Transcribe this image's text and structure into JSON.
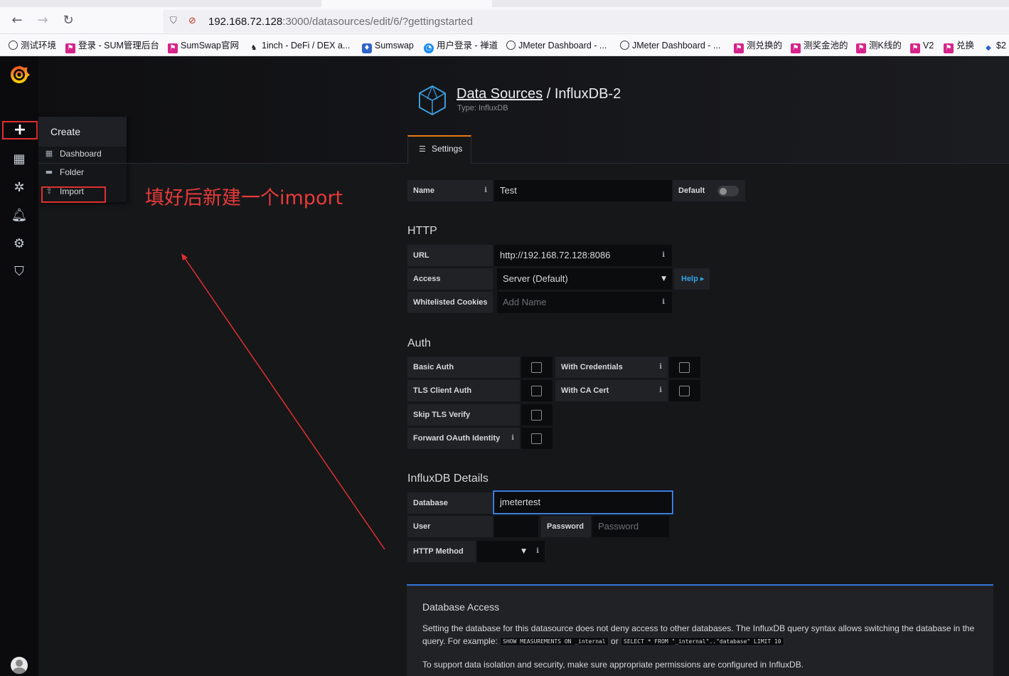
{
  "browser": {
    "url_host": "192.168.72.128",
    "url_path": ":3000/datasources/edit/6/?gettingstarted",
    "back_icon": "back-arrow-icon",
    "forward_icon": "forward-arrow-icon",
    "reload_icon": "reload-icon"
  },
  "bookmarks": [
    {
      "label": "测试环境",
      "icon": "globe-icon"
    },
    {
      "label": "登录 - SUM管理后台",
      "icon": "pink-flag-icon"
    },
    {
      "label": "SumSwap官网",
      "icon": "pink-flag-icon"
    },
    {
      "label": "1inch - DeFi / DEX a...",
      "icon": "unicorn-icon"
    },
    {
      "label": "Sumswap",
      "icon": "sumswap-icon"
    },
    {
      "label": "用户登录 - 禅道",
      "icon": "zentao-icon"
    },
    {
      "label": "JMeter Dashboard - ...",
      "icon": "globe-icon"
    },
    {
      "label": "JMeter Dashboard - ...",
      "icon": "globe-icon"
    },
    {
      "label": "测兑换的",
      "icon": "pink-flag-icon"
    },
    {
      "label": "测奖金池的",
      "icon": "pink-flag-icon"
    },
    {
      "label": "测K线的",
      "icon": "pink-flag-icon"
    },
    {
      "label": "V2",
      "icon": "pink-flag-icon"
    },
    {
      "label": "兑换",
      "icon": "pink-flag-icon"
    },
    {
      "label": "$2",
      "icon": "diamond-icon"
    }
  ],
  "sidemenu": {
    "create_menu": {
      "title": "Create",
      "items": [
        {
          "label": "Dashboard",
          "icon": "dashboard-icon"
        },
        {
          "label": "Folder",
          "icon": "folder-icon"
        },
        {
          "label": "Import",
          "icon": "import-icon"
        }
      ]
    }
  },
  "annotation": {
    "text": "填好后新建一个import",
    "color": "#e83a3a"
  },
  "header": {
    "breadcrumb_link": "Data Sources",
    "separator": " / ",
    "title": "InfluxDB-2",
    "subtitle": "Type: InfluxDB"
  },
  "tabs": [
    {
      "label": "Settings",
      "active": true
    }
  ],
  "form": {
    "name_label": "Name",
    "name_value": "Test",
    "default_label": "Default",
    "default_on": false,
    "http_title": "HTTP",
    "url_label": "URL",
    "url_value": "http://192.168.72.128:8086",
    "access_label": "Access",
    "access_value": "Server (Default)",
    "help_label": "Help ▸",
    "cookies_label": "Whitelisted Cookies",
    "cookies_placeholder": "Add Name",
    "auth_title": "Auth",
    "basic_auth": "Basic Auth",
    "with_credentials": "With Credentials",
    "tls_client_auth": "TLS Client Auth",
    "with_ca_cert": "With CA Cert",
    "skip_tls": "Skip TLS Verify",
    "forward_oauth": "Forward OAuth Identity",
    "influx_title": "InfluxDB Details",
    "database_label": "Database",
    "database_value": "jmetertest",
    "user_label": "User",
    "user_value": "",
    "password_label": "Password",
    "password_placeholder": "Password",
    "http_method_label": "HTTP Method",
    "http_method_value": ""
  },
  "info_panel": {
    "title": "Database Access",
    "text_part1": "Setting the database for this datasource does not deny access to other databases. The InfluxDB query syntax allows switching the database in the query. For example:",
    "code1": "SHOW MEASUREMENTS ON _internal",
    "or": "or",
    "code2": "SELECT * FROM \"_internal\"..\"database\" LIMIT 10",
    "text_part2": "To support data isolation and security, make sure appropriate permissions are configured in InfluxDB."
  },
  "colors": {
    "accent_orange": "#eb7b18",
    "focus_blue": "#5794f2",
    "highlight_red": "#e02f2f",
    "background": "#161719"
  }
}
